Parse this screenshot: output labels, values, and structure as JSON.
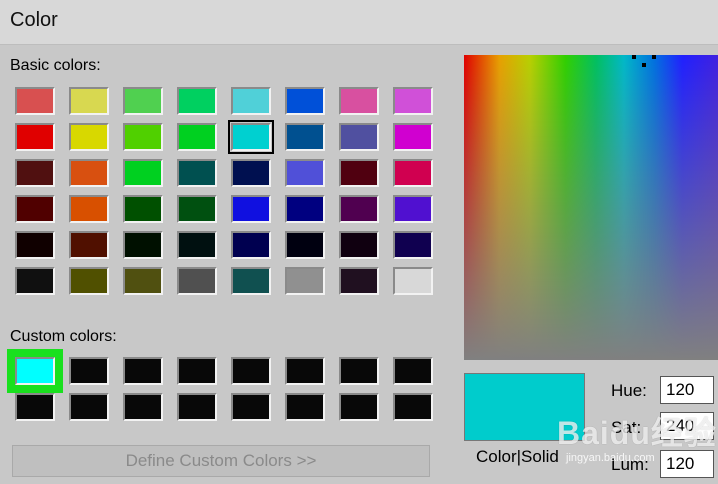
{
  "window": {
    "title": "Color"
  },
  "basic_colors": {
    "label": "Basic colors:",
    "swatches": [
      "#d85050",
      "#d8d850",
      "#50d050",
      "#00d060",
      "#50d0d8",
      "#0050d8",
      "#d850a0",
      "#d050d8",
      "#e00000",
      "#d8d800",
      "#50d000",
      "#00d020",
      "#00d0d0",
      "#005090",
      "#5050a0",
      "#d000d0",
      "#501010",
      "#d85010",
      "#00d020",
      "#005050",
      "#001050",
      "#5050d8",
      "#500010",
      "#d00050",
      "#500000",
      "#d85000",
      "#005000",
      "#005010",
      "#1010e0",
      "#000080",
      "#500050",
      "#5010d0",
      "#100000",
      "#501000",
      "#001000",
      "#001010",
      "#000050",
      "#000010",
      "#100010",
      "#100050",
      "#101010",
      "#505000",
      "#505010",
      "#505050",
      "#105050",
      "#909090",
      "#201020",
      "#d8d8d8"
    ],
    "selected_index": 12
  },
  "custom_colors": {
    "label": "Custom colors:",
    "swatches": [
      "#00ffff",
      "#080808",
      "#080808",
      "#080808",
      "#080808",
      "#080808",
      "#080808",
      "#080808",
      "#080808",
      "#080808",
      "#080808",
      "#080808",
      "#080808",
      "#080808",
      "#080808",
      "#080808"
    ],
    "selected_index": 0
  },
  "define_button": {
    "label": "Define Custom Colors >>"
  },
  "preview": {
    "color": "#00cccc",
    "label": "Color|Solid"
  },
  "fields": {
    "hue": {
      "label": "Hue:",
      "value": "120"
    },
    "sat": {
      "label": "Sat:",
      "value": "240"
    },
    "lum": {
      "label": "Lum:",
      "value": "120"
    }
  },
  "watermark": {
    "text": "Baidu经验",
    "sub": "jingyan.baidu.com"
  }
}
